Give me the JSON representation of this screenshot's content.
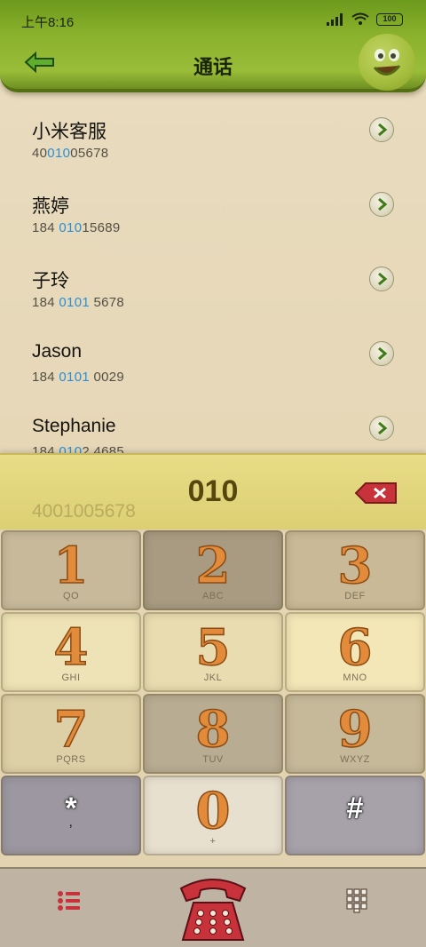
{
  "status": {
    "time": "上午8:16",
    "battery": "100"
  },
  "header": {
    "title": "通话",
    "back_icon": "arrow-left-icon",
    "avatar_icon": "smiley-icon"
  },
  "contacts": [
    {
      "name": "小米客服",
      "number_pre": "40",
      "number_hl": "010",
      "number_post": "05678"
    },
    {
      "name": "燕婷",
      "number_pre": "184 ",
      "number_hl": "010",
      "number_post": "15689"
    },
    {
      "name": "子玲",
      "number_pre": "184 ",
      "number_hl": "0101",
      "number_post": " 5678"
    },
    {
      "name": "Jason",
      "number_pre": "184 ",
      "number_hl": "0101",
      "number_post": " 0029"
    },
    {
      "name": "Stephanie",
      "number_pre": "184 ",
      "number_hl": "010",
      "number_post": "2 4685"
    }
  ],
  "dial": {
    "input": "010",
    "suggestion": "4001005678",
    "delete_icon": "backspace-icon"
  },
  "keypad": [
    {
      "digit": "1",
      "letters": "QO"
    },
    {
      "digit": "2",
      "letters": "ABC"
    },
    {
      "digit": "3",
      "letters": "DEF"
    },
    {
      "digit": "4",
      "letters": "GHI"
    },
    {
      "digit": "5",
      "letters": "JKL"
    },
    {
      "digit": "6",
      "letters": "MNO"
    },
    {
      "digit": "7",
      "letters": "PQRS"
    },
    {
      "digit": "8",
      "letters": "TUV"
    },
    {
      "digit": "9",
      "letters": "WXYZ"
    },
    {
      "digit": "*",
      "letters": ","
    },
    {
      "digit": "0",
      "letters": "+"
    },
    {
      "digit": "#",
      "letters": ""
    }
  ],
  "colors": {
    "header_green": "#8bb22d",
    "highlight_blue": "#2a8fd6",
    "digit_orange": "#e28b3b",
    "call_red": "#c8323a"
  }
}
